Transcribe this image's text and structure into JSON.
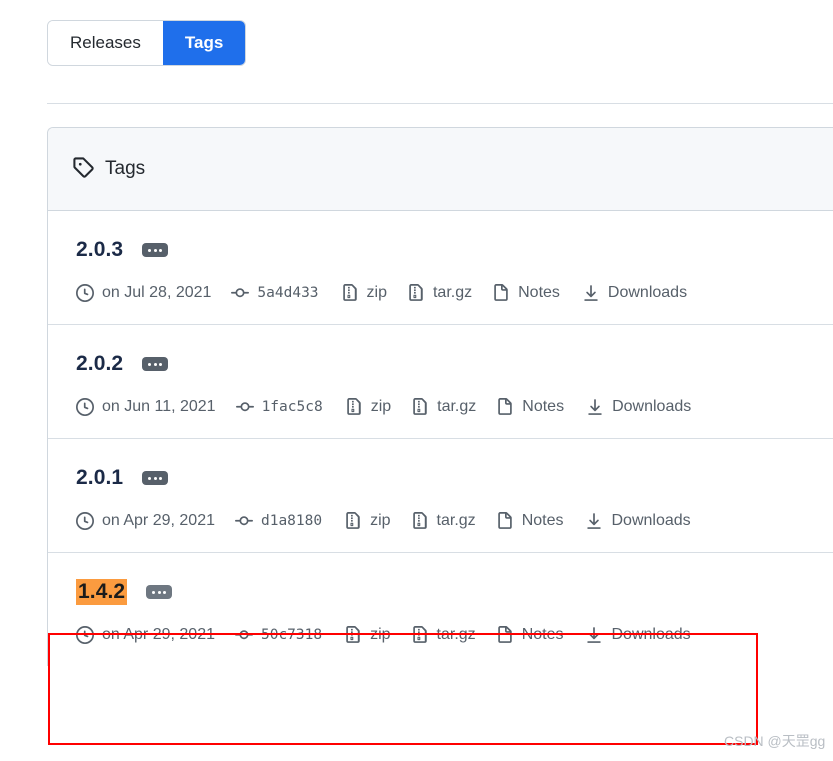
{
  "tabs": [
    {
      "label": "Releases",
      "active": false,
      "name": "tab-releases"
    },
    {
      "label": "Tags",
      "active": true,
      "name": "tab-tags"
    }
  ],
  "card": {
    "header_title": "Tags",
    "header_icon": "tag-icon"
  },
  "icons": {
    "clock": "clock-icon",
    "commit": "commit-icon",
    "file_zip": "file-zip-icon",
    "file_page": "file-page-icon",
    "download": "download-icon",
    "dots": "kebab-dots-icon"
  },
  "labels": {
    "zip": "zip",
    "targz": "tar.gz",
    "notes": "Notes",
    "downloads": "Downloads"
  },
  "tags": [
    {
      "version": "2.0.3",
      "date": "on Jul 28, 2021",
      "commit": "5a4d433",
      "zip": "zip",
      "targz": "tar.gz",
      "notes": "Notes",
      "downloads": "Downloads",
      "highlighted": false
    },
    {
      "version": "2.0.2",
      "date": "on Jun 11, 2021",
      "commit": "1fac5c8",
      "zip": "zip",
      "targz": "tar.gz",
      "notes": "Notes",
      "downloads": "Downloads",
      "highlighted": false
    },
    {
      "version": "2.0.1",
      "date": "on Apr 29, 2021",
      "commit": "d1a8180",
      "zip": "zip",
      "targz": "tar.gz",
      "notes": "Notes",
      "downloads": "Downloads",
      "highlighted": false
    },
    {
      "version": "1.4.2",
      "date": "on Apr 29, 2021",
      "commit": "50c7318",
      "zip": "zip",
      "targz": "tar.gz",
      "notes": "Notes",
      "downloads": "Downloads",
      "highlighted": true
    }
  ],
  "annotation": {
    "highlight_color": "#fb9b3f",
    "box_color": "#ff0000"
  },
  "watermark": {
    "text": "CSDN @天罡gg"
  }
}
